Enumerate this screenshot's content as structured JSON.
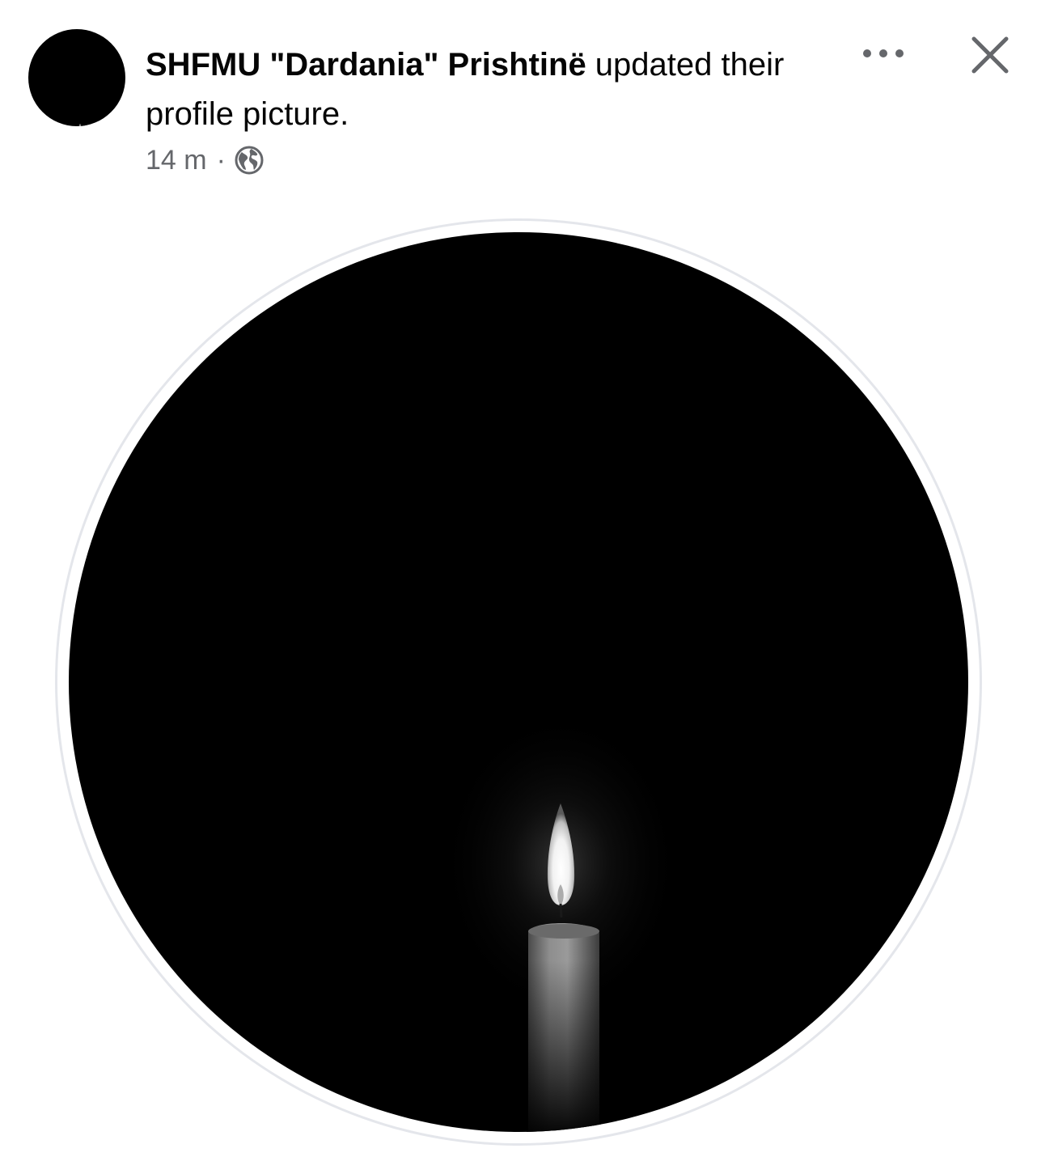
{
  "post": {
    "page_name": "SHFMU \"Dardania\" Prishtinë",
    "action_text": " updated their profile picture.",
    "timestamp": "14 m",
    "separator": "·",
    "audience_icon": "globe-icon"
  },
  "toolbar": {
    "more_icon": "more-horizontal-icon",
    "close_icon": "close-icon"
  },
  "photo": {
    "subject_icon": "candle-icon"
  },
  "colors": {
    "primary_text": "#050505",
    "secondary_text": "#65676b",
    "photo_background": "#000000",
    "frame_border": "#e4e6eb"
  }
}
